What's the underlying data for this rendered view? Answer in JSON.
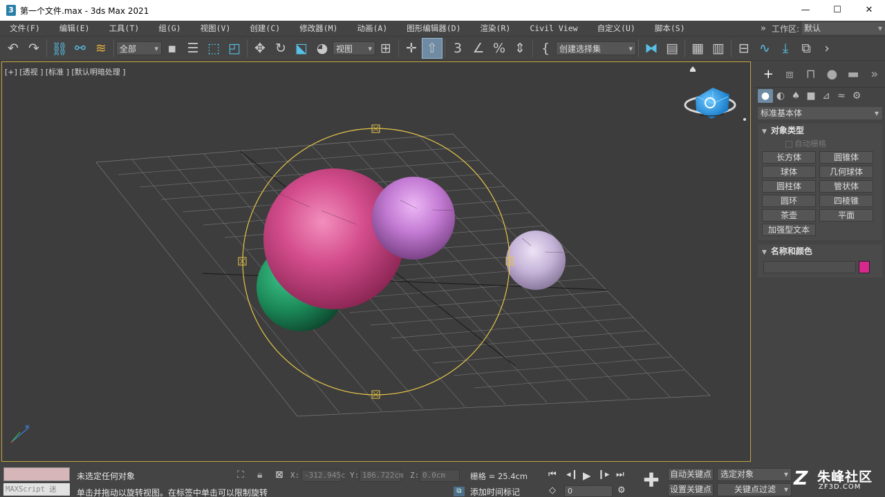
{
  "window": {
    "icon": "3",
    "title": "第一个文件.max - 3ds Max 2021",
    "min": "—",
    "max": "☐",
    "close": "✕"
  },
  "menu": {
    "items": [
      "文件(F)",
      "编辑(E)",
      "工具(T)",
      "组(G)",
      "视图(V)",
      "创建(C)",
      "修改器(M)",
      "动画(A)",
      "图形编辑器(D)",
      "渲染(R)",
      "Civil View",
      "自定义(U)",
      "脚本(S)"
    ],
    "chevron": "»",
    "workspace_label": "工作区:",
    "workspace_value": "默认"
  },
  "toolbar": {
    "selection_filter": "全部",
    "reference_coord": "视图",
    "named_selection": "创建选择集",
    "icons": [
      "undo-icon",
      "redo-icon",
      "link-icon",
      "unlink-icon",
      "bind-space-warp-icon",
      "select-object-icon",
      "select-by-name-icon",
      "rect-region-icon",
      "window-crossing-icon",
      "move-icon",
      "rotate-icon",
      "scale-icon",
      "place-icon",
      "pivot-icon",
      "select-manipulate-icon",
      "snap-3-icon",
      "angle-snap-icon",
      "percent-snap-icon",
      "spinner-snap-icon",
      "edit-named-sel-icon",
      "mirror-icon",
      "align-icon",
      "layer-icon",
      "scene-explorer-icon",
      "ribbon-icon",
      "curve-editor-icon",
      "schematic-icon",
      "material-editor-icon",
      "render-setup-icon"
    ]
  },
  "viewport": {
    "label": "[+] [透视 ] [标准 ] [默认明暗处理 ]",
    "sphere_colors": {
      "pink": "#c9407e",
      "violet": "#b772c6",
      "lilac": "#c7b6da",
      "green": "#1e8a5a"
    },
    "gizmo_color": "#e0c040"
  },
  "command_panel": {
    "tabs": [
      "create-icon",
      "modify-icon",
      "hierarchy-icon",
      "motion-icon",
      "display-icon",
      "more-icon"
    ],
    "subtabs": [
      "geometry-icon",
      "shapes-icon",
      "lights-icon",
      "cameras-icon",
      "helpers-icon",
      "spacewarps-icon",
      "systems-icon"
    ],
    "category": "标准基本体",
    "object_type": {
      "title": "对象类型",
      "autogrid": "自动栅格",
      "buttons": [
        "长方体",
        "圆锥体",
        "球体",
        "几何球体",
        "圆柱体",
        "管状体",
        "圆环",
        "四棱锥",
        "茶壶",
        "平面",
        "加强型文本"
      ]
    },
    "name_color": {
      "title": "名称和颜色",
      "color": "#d8288c"
    }
  },
  "status": {
    "maxscript": "MAXScript 迷",
    "selection": "未选定任何对象",
    "prompt": "单击并拖动以旋转视图。在标签中单击可以限制旋转",
    "x_label": "X:",
    "x_value": "-312.945c",
    "y_label": "Y:",
    "y_value": "186.722cm",
    "z_label": "Z:",
    "z_value": "0.0cm",
    "grid": "栅格 = 25.4cm",
    "add_time_tag": "添加时间标记",
    "frame": "0",
    "auto_key": "自动关键点",
    "set_key": "设置关键点",
    "selected_object": "选定对象",
    "key_filters": "关键点过滤器..."
  },
  "watermark": {
    "logo": "Z",
    "name": "朱峰社区",
    "sub": "ZF3D.COM"
  }
}
